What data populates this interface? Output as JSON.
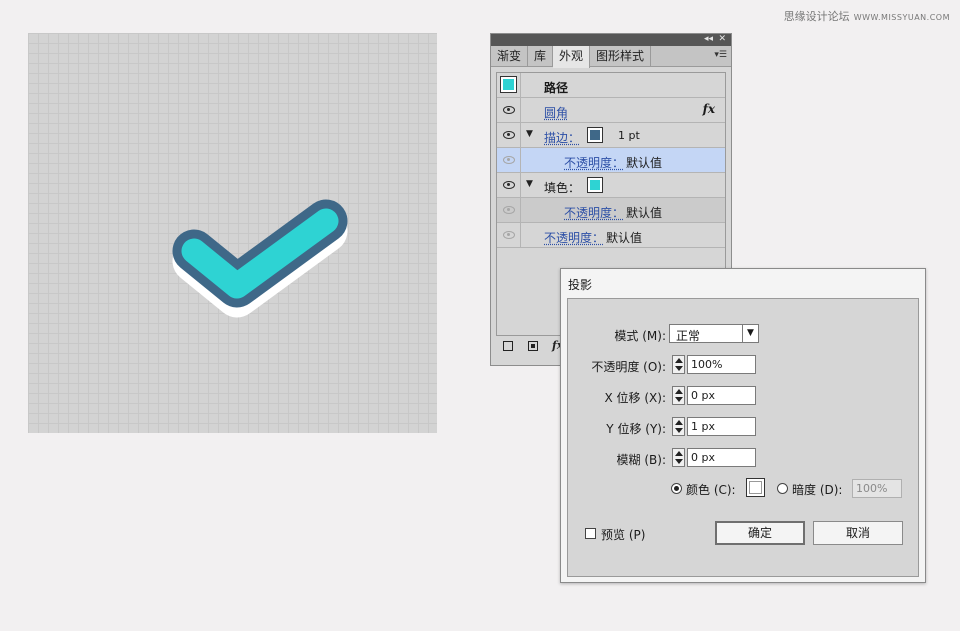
{
  "watermark": {
    "text": "思缘设计论坛",
    "site": "WWW.MISSYUAN.COM"
  },
  "colors": {
    "fill": "#2ed3d3",
    "stroke": "#3f6888",
    "shadow": "#ffffff",
    "selected_row": "#c4d6f5"
  },
  "appearance_panel": {
    "tabs": [
      {
        "label": "渐变",
        "active": false
      },
      {
        "label": "库",
        "active": false
      },
      {
        "label": "外观",
        "active": true
      },
      {
        "label": "图形样式",
        "active": false
      }
    ],
    "header_label": "路径",
    "rows": [
      {
        "label": "圆角",
        "fx": "fx"
      },
      {
        "label": "描边：",
        "value": "1 pt"
      },
      {
        "label": "不透明度：",
        "value": "默认值"
      },
      {
        "label": "填色："
      },
      {
        "label": "不透明度：",
        "value": "默认值"
      },
      {
        "label": "不透明度：",
        "value": "默认值"
      }
    ],
    "footer_fx": "fx"
  },
  "drop_shadow_dialog": {
    "title": "投影",
    "mode_label": "模式 (M):",
    "mode_value": "正常",
    "opacity_label": "不透明度 (O):",
    "opacity_value": "100%",
    "x_offset_label": "X 位移 (X):",
    "x_offset_value": "0 px",
    "y_offset_label": "Y 位移 (Y):",
    "y_offset_value": "1 px",
    "blur_label": "模糊 (B):",
    "blur_value": "0 px",
    "color_label": "颜色 (C):",
    "darkness_label": "暗度 (D):",
    "darkness_value": "100%",
    "preview_label": "预览 (P)",
    "ok_label": "确定",
    "cancel_label": "取消"
  }
}
